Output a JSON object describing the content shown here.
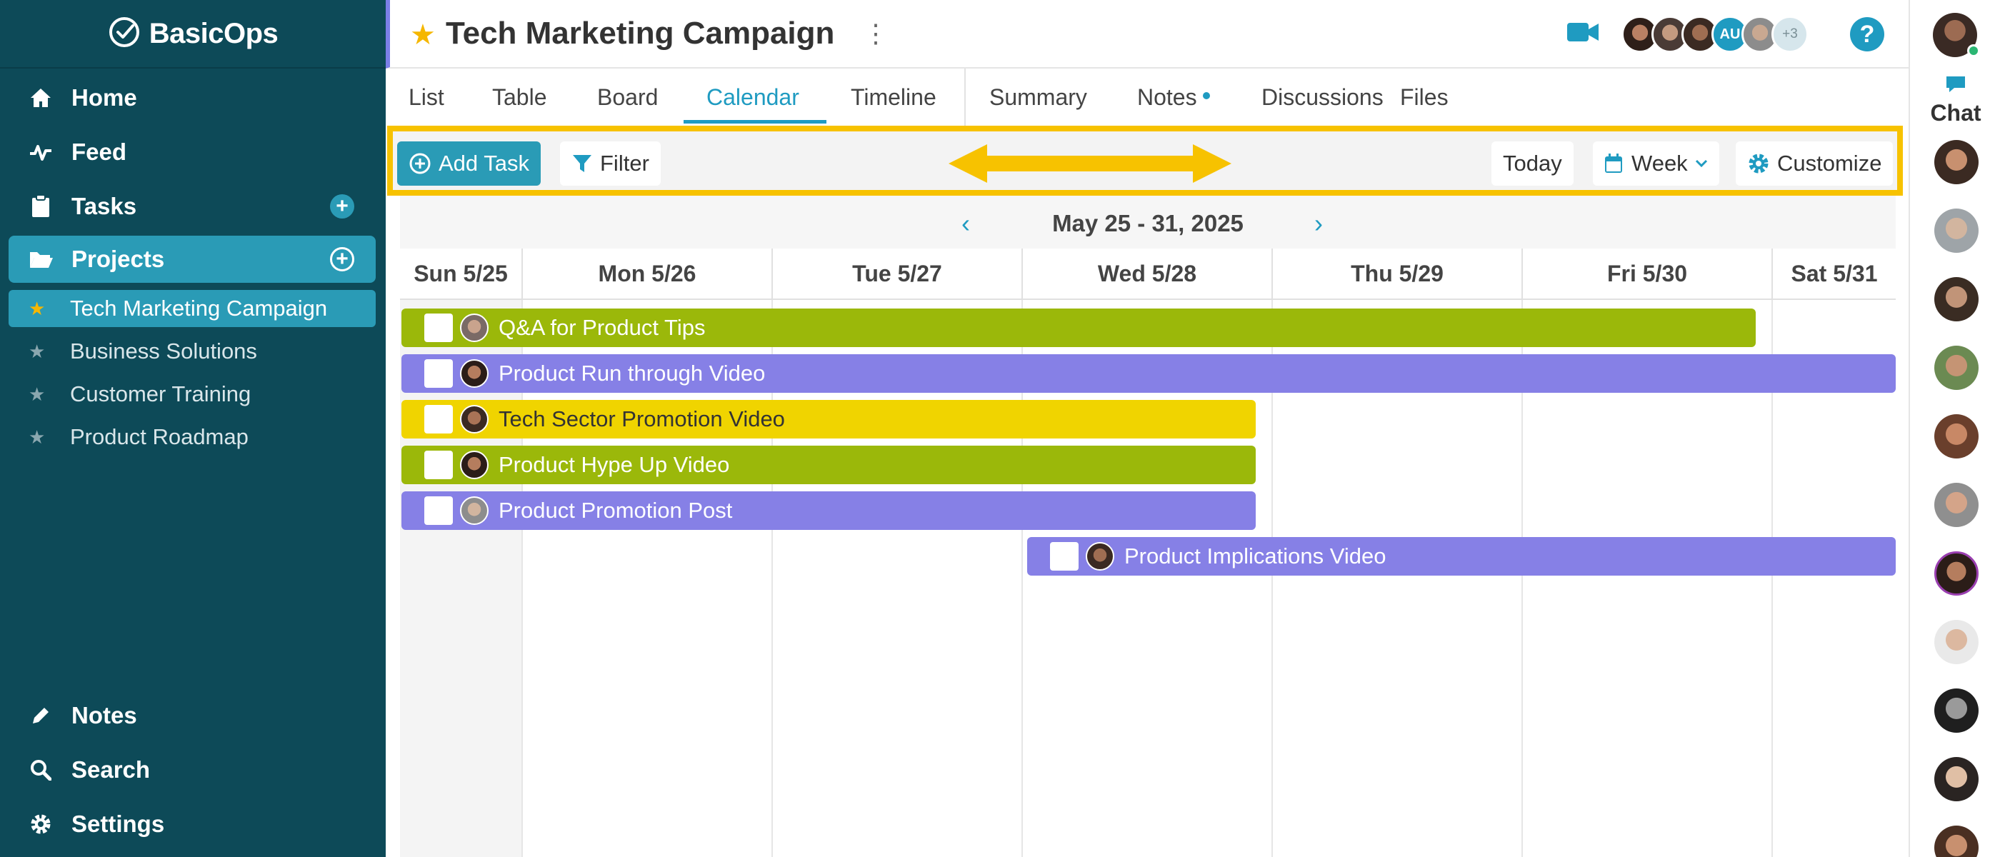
{
  "brand": {
    "name": "BasicOps"
  },
  "sidebar": {
    "nav": [
      {
        "label": "Home",
        "icon": "home-icon"
      },
      {
        "label": "Feed",
        "icon": "activity-icon"
      },
      {
        "label": "Tasks",
        "icon": "clipboard-icon"
      },
      {
        "label": "Projects",
        "icon": "folder-open-icon"
      }
    ],
    "projects": [
      {
        "label": "Tech Marketing Campaign",
        "active": true
      },
      {
        "label": "Business Solutions"
      },
      {
        "label": "Customer Training"
      },
      {
        "label": "Product Roadmap"
      }
    ],
    "bottom": [
      {
        "label": "Notes",
        "icon": "pencil-icon"
      },
      {
        "label": "Search",
        "icon": "search-icon"
      },
      {
        "label": "Settings",
        "icon": "gear-icon"
      }
    ]
  },
  "header": {
    "title": "Tech Marketing Campaign",
    "member_initials": "AU",
    "member_more": "+3",
    "help": "?"
  },
  "tabs": [
    {
      "label": "List"
    },
    {
      "label": "Table"
    },
    {
      "label": "Board"
    },
    {
      "label": "Calendar",
      "active": true
    },
    {
      "label": "Timeline"
    },
    {
      "label": "Summary"
    },
    {
      "label": "Notes"
    },
    {
      "label": "Discussions"
    },
    {
      "label": "Files"
    }
  ],
  "toolbar": {
    "add_task": "Add Task",
    "filter": "Filter",
    "today": "Today",
    "view": "Week",
    "customize": "Customize"
  },
  "calendar": {
    "range": "May 25 - 31, 2025",
    "days": [
      "Sun 5/25",
      "Mon 5/26",
      "Tue 5/27",
      "Wed 5/28",
      "Thu 5/29",
      "Fri 5/30",
      "Sat 5/31"
    ],
    "tasks": [
      {
        "name": "Q&A for Product Tips",
        "color": "#9bb80a"
      },
      {
        "name": "Product Run through Video",
        "color": "#8680e6"
      },
      {
        "name": "Tech Sector Promotion Video",
        "color": "#f0d400"
      },
      {
        "name": "Product Hype Up Video",
        "color": "#9bb80a"
      },
      {
        "name": "Product Promotion Post",
        "color": "#8680e6"
      },
      {
        "name": "Product Implications Video",
        "color": "#8680e6"
      }
    ]
  },
  "chat": {
    "label": "Chat"
  },
  "colors": {
    "sidebar_bg": "#0d4a58",
    "accent": "#2a9bb6",
    "highlight": "#f7c200",
    "green_task": "#9bb80a",
    "purple_task": "#8680e6",
    "yellow_task": "#f0d400"
  }
}
